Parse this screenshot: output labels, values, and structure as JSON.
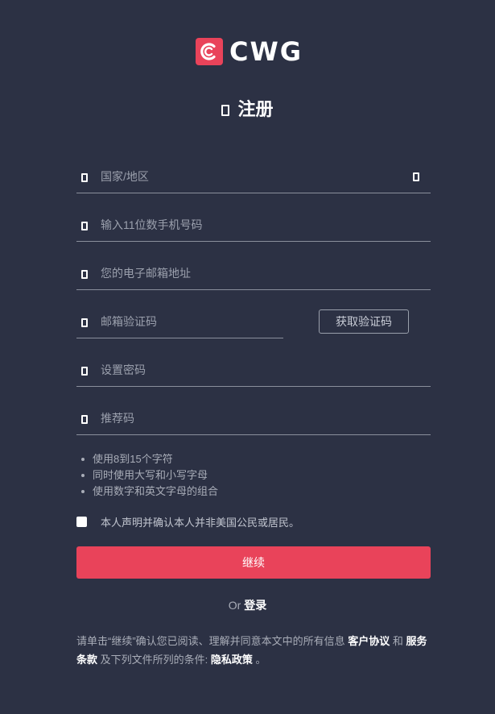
{
  "brand": {
    "name": "CWG",
    "accent": "#e9435a"
  },
  "title": "注册",
  "fields": {
    "country": {
      "placeholder": "国家/地区",
      "value": ""
    },
    "phone": {
      "placeholder": "输入11位数手机号码",
      "value": ""
    },
    "email": {
      "placeholder": "您的电子邮箱地址",
      "value": ""
    },
    "email_code": {
      "placeholder": "邮箱验证码",
      "value": ""
    },
    "password": {
      "placeholder": "设置密码",
      "value": ""
    },
    "referral": {
      "placeholder": "推荐码",
      "value": ""
    }
  },
  "get_code_label": "获取验证码",
  "password_rules": [
    "使用8到15个字符",
    "同时使用大写和小写字母",
    "使用数字和英文字母的组合"
  ],
  "declaration": {
    "text": "本人声明并确认本人并非美国公民或居民。",
    "checked": false
  },
  "continue_label": "继续",
  "or_text": "Or",
  "login_label": "登录",
  "terms": {
    "prefix": "请单击“继续”确认您已阅读、理解并同意本文中的所有信息 ",
    "customer_agreement": "客户协议",
    "and": " 和 ",
    "service_terms": "服务条款",
    "middle": " 及下列文件所列的条件: ",
    "privacy_policy": "隐私政策",
    "suffix": " 。"
  }
}
